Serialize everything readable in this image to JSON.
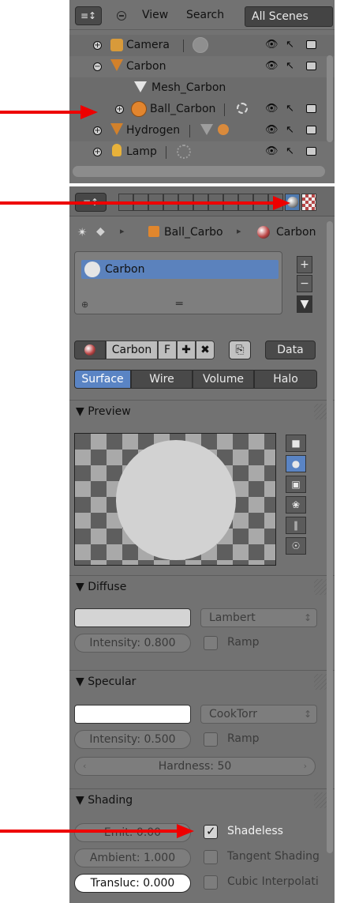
{
  "outliner": {
    "editor_icon": "≡↕",
    "view_label": "View",
    "search_label": "Search",
    "scene_filter": "All Scenes",
    "rows": [
      {
        "label": "Camera",
        "expander": "+"
      },
      {
        "label": "Carbon",
        "expander": "−"
      },
      {
        "label": "Mesh_Carbon",
        "expander": ""
      },
      {
        "label": "Ball_Carbon",
        "expander": "+"
      },
      {
        "label": "Hydrogen",
        "expander": "+"
      },
      {
        "label": "Lamp",
        "expander": "+"
      }
    ],
    "eye_glyph": "👁",
    "pointer_glyph": "↖"
  },
  "properties": {
    "breadcrumb": {
      "object": "Ball_Carbo",
      "material": "Carbon"
    },
    "slots": [
      "Carbon"
    ],
    "slot_buttons": {
      "add": "+",
      "remove": "−",
      "down": "▼"
    },
    "material_name": "Carbon",
    "fake_user": "F",
    "data_dropdown": "Data",
    "tabs": [
      "Surface",
      "Wire",
      "Volume",
      "Halo"
    ],
    "panels": {
      "preview": "Preview",
      "diffuse": "Diffuse",
      "specular": "Specular",
      "shading": "Shading"
    },
    "diffuse": {
      "shader": "Lambert",
      "intensity": "Intensity: 0.800",
      "ramp": "Ramp",
      "color": "#d4d4d4"
    },
    "specular": {
      "shader": "CookTorr",
      "intensity": "Intensity: 0.500",
      "ramp": "Ramp",
      "hardness": "Hardness: 50",
      "color": "#ffffff"
    },
    "shading": {
      "emit": "Emit: 0.00",
      "ambient": "Ambient: 1.000",
      "transluc": "Transluc: 0.000",
      "shadeless": "Shadeless",
      "shadeless_checked": true,
      "tangent": "Tangent Shading",
      "cubic": "Cubic Interpolati"
    }
  },
  "colors": {
    "annotation": "#ee0000",
    "panel_bg": "#727272",
    "selection": "#5a84c4"
  }
}
